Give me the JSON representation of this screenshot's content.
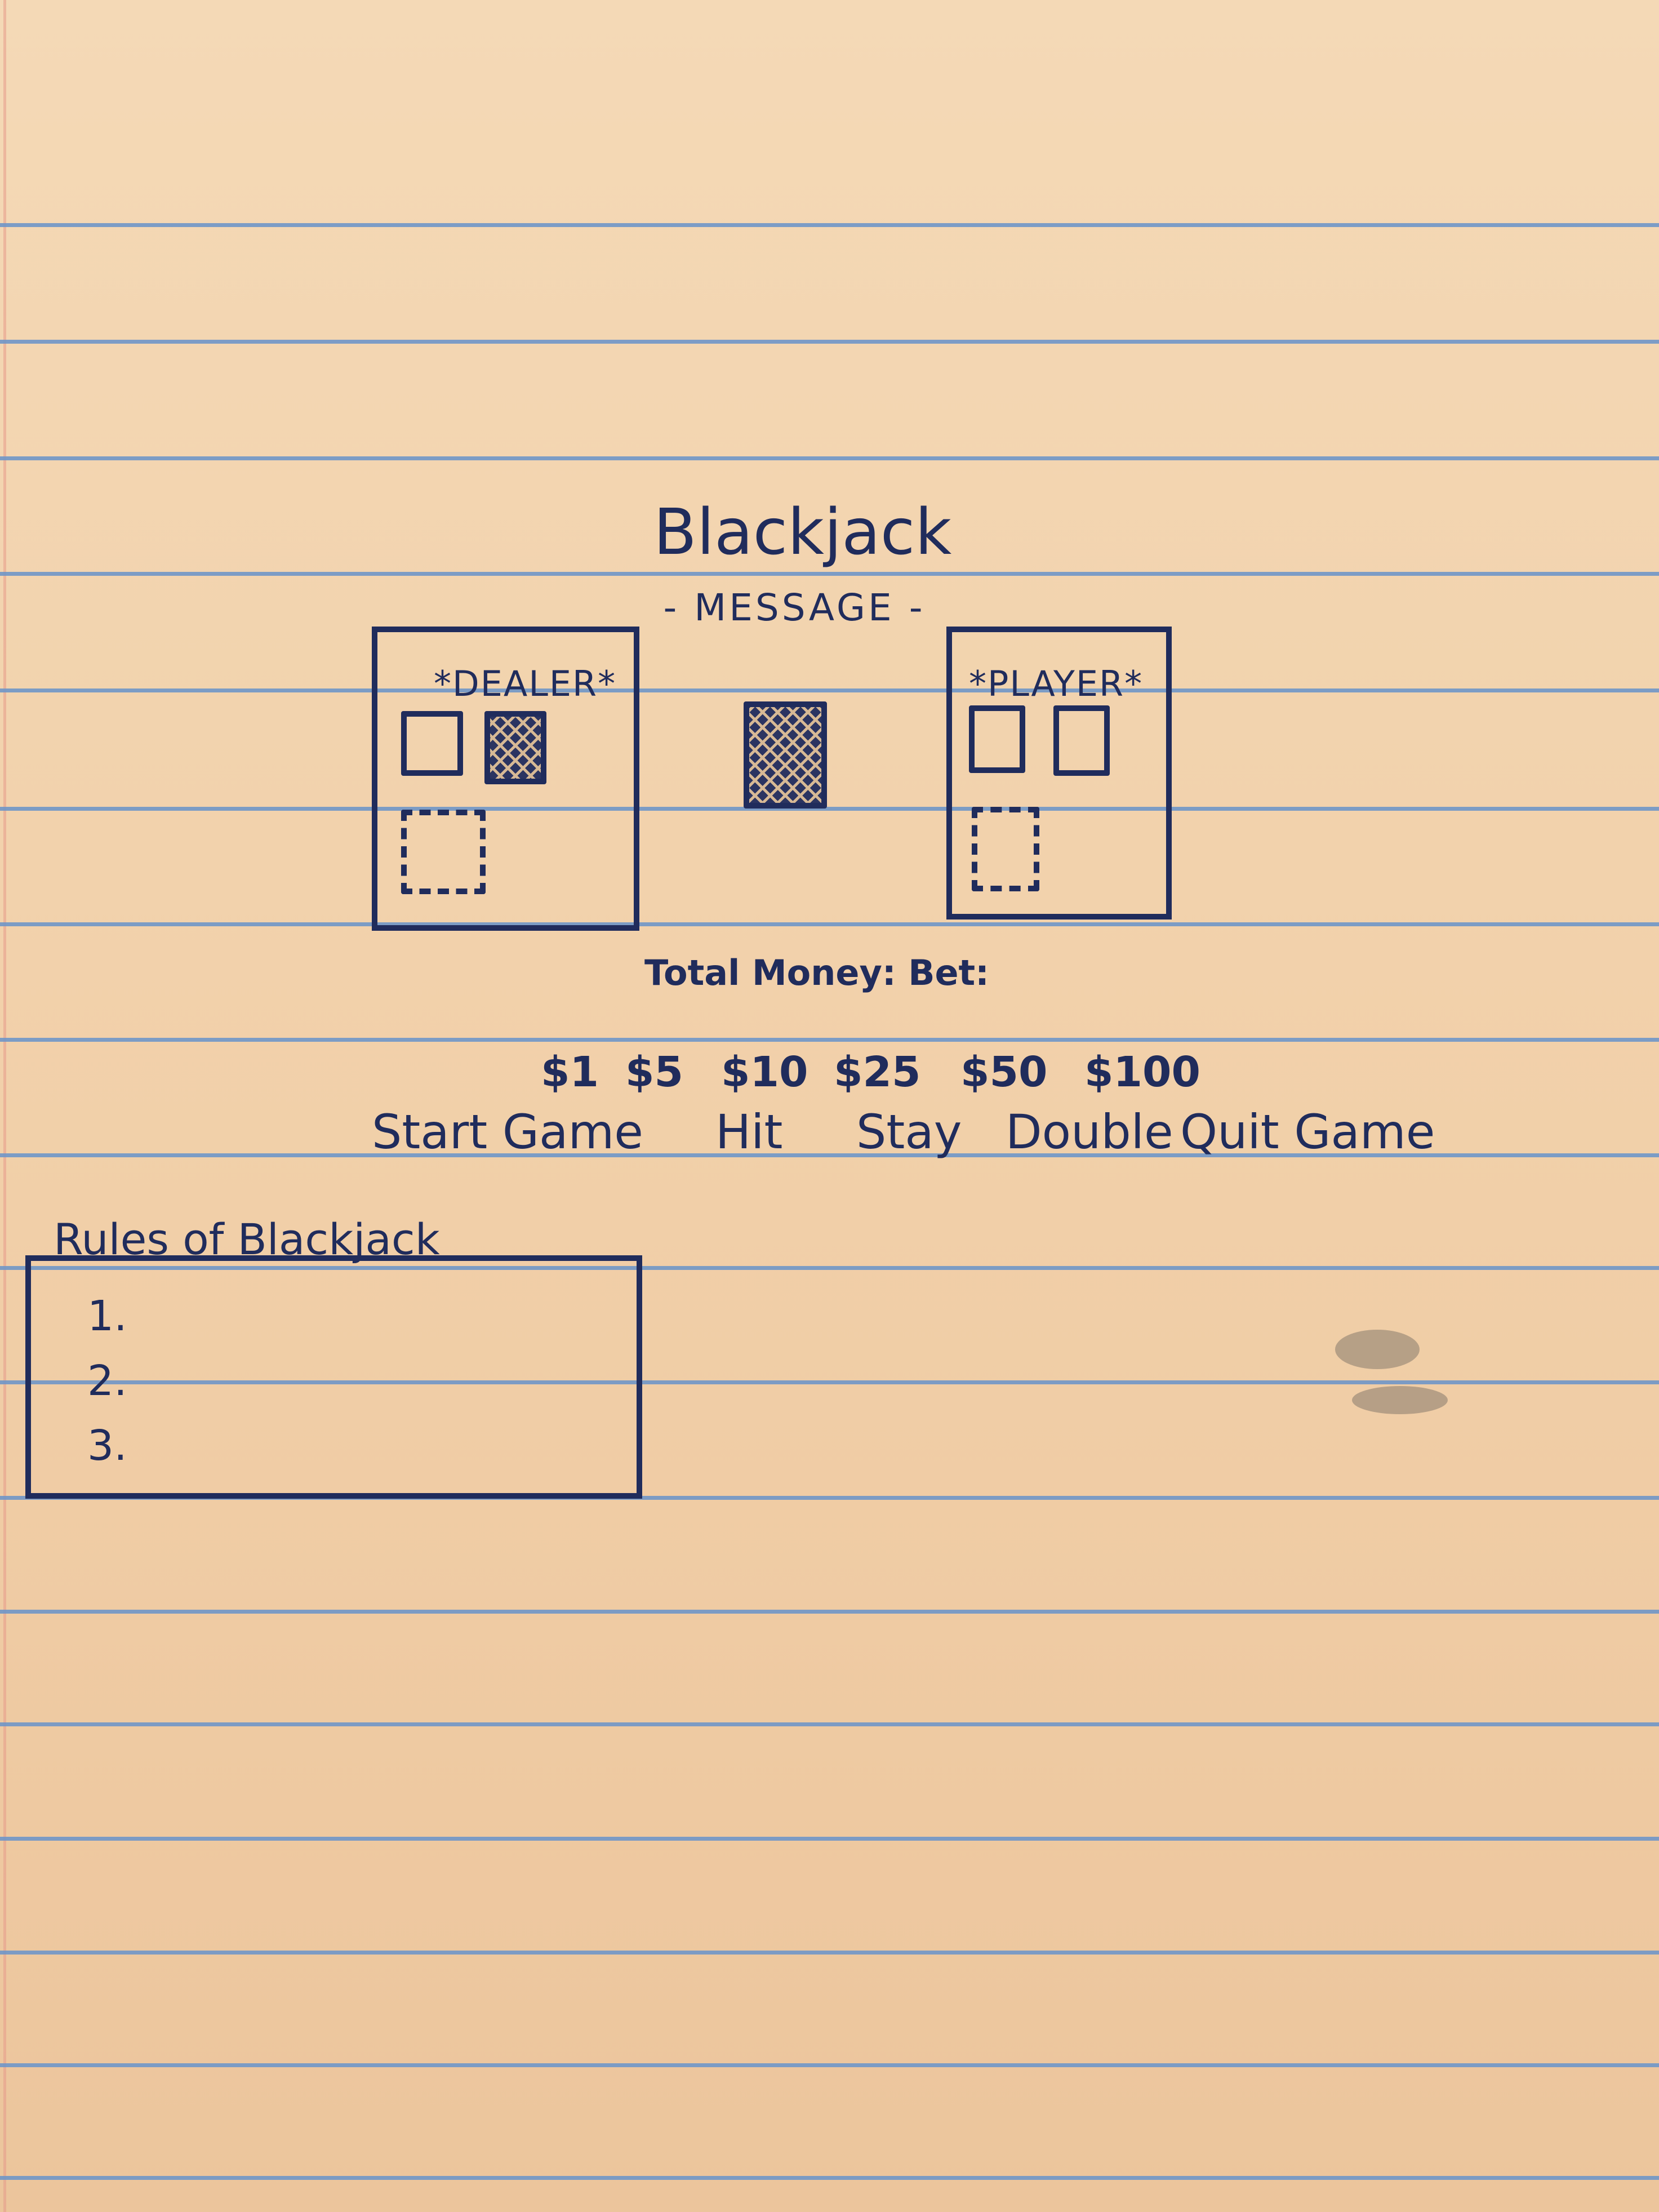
{
  "title": "Blackjack",
  "message": "- MESSAGE -",
  "dealer": {
    "label": "*DEALER*"
  },
  "player": {
    "label": "*PLAYER*"
  },
  "status": {
    "text": "Total Money: Bet:"
  },
  "bet_chips": [
    "$1",
    "$5",
    "$10",
    "$25",
    "$50",
    "$100"
  ],
  "actions": [
    "Start Game",
    "Hit",
    "Stay",
    "Double",
    "Quit Game"
  ],
  "rules": {
    "heading": "Rules of Blackjack",
    "items": [
      "1.",
      "2.",
      "3."
    ]
  }
}
